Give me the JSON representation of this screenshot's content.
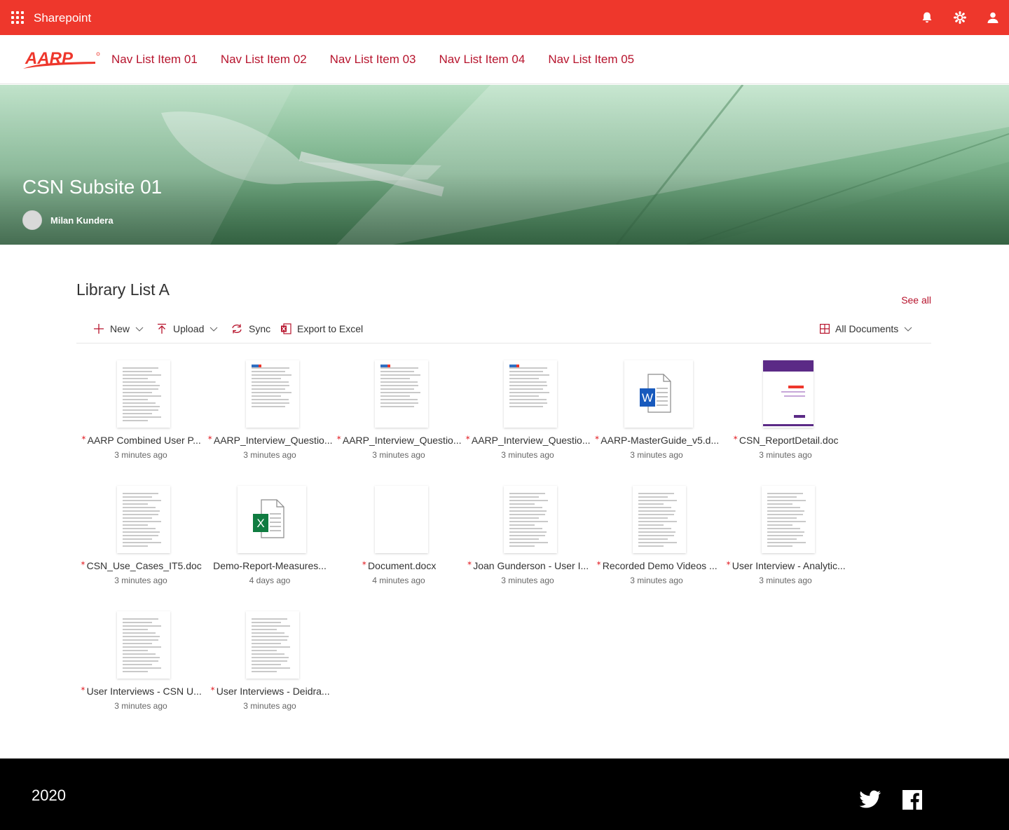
{
  "suite": {
    "title": "Sharepoint",
    "icons": [
      "bell-icon",
      "gear-icon",
      "person-icon"
    ]
  },
  "brand": {
    "logo_text": "AARP",
    "accent": "#ee372c",
    "nav_color": "#b7142d"
  },
  "nav": {
    "items": [
      "Nav List Item 01",
      "Nav List Item 02",
      "Nav List Item 03",
      "Nav List Item 04",
      "Nav List Item 05"
    ]
  },
  "hero": {
    "title": "CSN Subsite 01",
    "owner": "Milan Kundera"
  },
  "library": {
    "title": "Library List A",
    "see_all": "See all",
    "commands": {
      "new": "New",
      "upload": "Upload",
      "sync": "Sync",
      "export": "Export to Excel",
      "view": "All Documents"
    },
    "files": [
      {
        "name": "AARP Combined User P...",
        "date": "3 minutes ago",
        "kind": "doc",
        "new": true
      },
      {
        "name": "AARP_Interview_Questio...",
        "date": "3 minutes ago",
        "kind": "ciber",
        "new": true
      },
      {
        "name": "AARP_Interview_Questio...",
        "date": "3 minutes ago",
        "kind": "ciber",
        "new": true
      },
      {
        "name": "AARP_Interview_Questio...",
        "date": "3 minutes ago",
        "kind": "ciber",
        "new": true
      },
      {
        "name": "AARP-MasterGuide_v5.d...",
        "date": "3 minutes ago",
        "kind": "word",
        "new": true
      },
      {
        "name": "CSN_ReportDetail.doc",
        "date": "3 minutes ago",
        "kind": "report",
        "new": true
      },
      {
        "name": "CSN_Use_Cases_IT5.doc",
        "date": "3 minutes ago",
        "kind": "doc",
        "new": true
      },
      {
        "name": "Demo-Report-Measures...",
        "date": "4 days ago",
        "kind": "excel",
        "new": false
      },
      {
        "name": "Document.docx",
        "date": "4 minutes ago",
        "kind": "blank",
        "new": true
      },
      {
        "name": "Joan Gunderson - User I...",
        "date": "3 minutes ago",
        "kind": "doc",
        "new": true
      },
      {
        "name": "Recorded Demo Videos ...",
        "date": "3 minutes ago",
        "kind": "doc",
        "new": true
      },
      {
        "name": "User Interview - Analytic...",
        "date": "3 minutes ago",
        "kind": "doc",
        "new": true
      },
      {
        "name": "User Interviews - CSN U...",
        "date": "3 minutes ago",
        "kind": "doc",
        "new": true
      },
      {
        "name": "User Interviews - Deidra...",
        "date": "3 minutes ago",
        "kind": "doc",
        "new": true
      }
    ]
  },
  "footer": {
    "year": "2020",
    "social": [
      "twitter-icon",
      "facebook-icon"
    ]
  }
}
